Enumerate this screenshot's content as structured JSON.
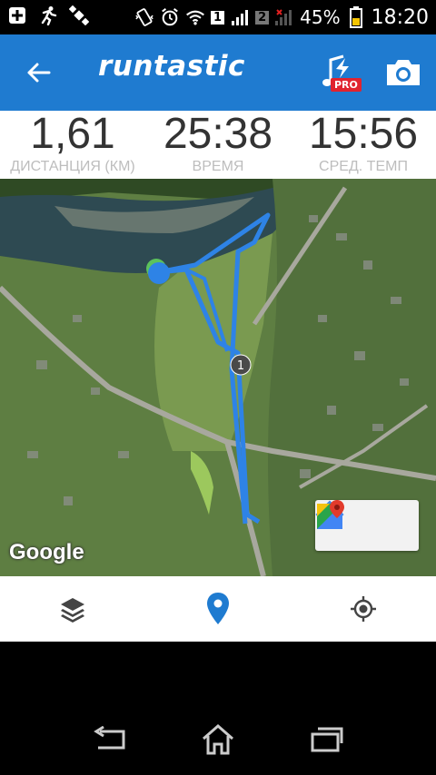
{
  "status_bar": {
    "battery_percent": "45%",
    "clock": "18:20",
    "sim1": "1",
    "sim2": "2",
    "icons": [
      "plus-icon",
      "runner-icon",
      "satellite-icon",
      "vibrate-icon",
      "alarm-icon",
      "wifi-icon",
      "signal-icon",
      "battery-icon"
    ]
  },
  "app_bar": {
    "logo": "runtastic",
    "pro_badge": "PRO",
    "icons": [
      "back-arrow-icon",
      "music-icon",
      "camera-icon"
    ]
  },
  "stats": [
    {
      "value": "1,61",
      "label": "ДИСТАНЦИЯ (КМ)"
    },
    {
      "value": "25:38",
      "label": "ВРЕМЯ"
    },
    {
      "value": "15:56",
      "label": "СРЕД. ТЕМП"
    }
  ],
  "map": {
    "provider_logo": "Google",
    "km_marker": "1",
    "route_color": "#2e83e6",
    "buttons": [
      "directions-icon",
      "google-maps-icon"
    ]
  },
  "bottom_bar": {
    "icons": [
      "layers-icon",
      "location-pin-icon",
      "my-location-icon"
    ],
    "active_color": "#1f7bd0"
  },
  "nav_bar": {
    "icons": [
      "back-icon",
      "home-icon",
      "recents-icon"
    ]
  }
}
